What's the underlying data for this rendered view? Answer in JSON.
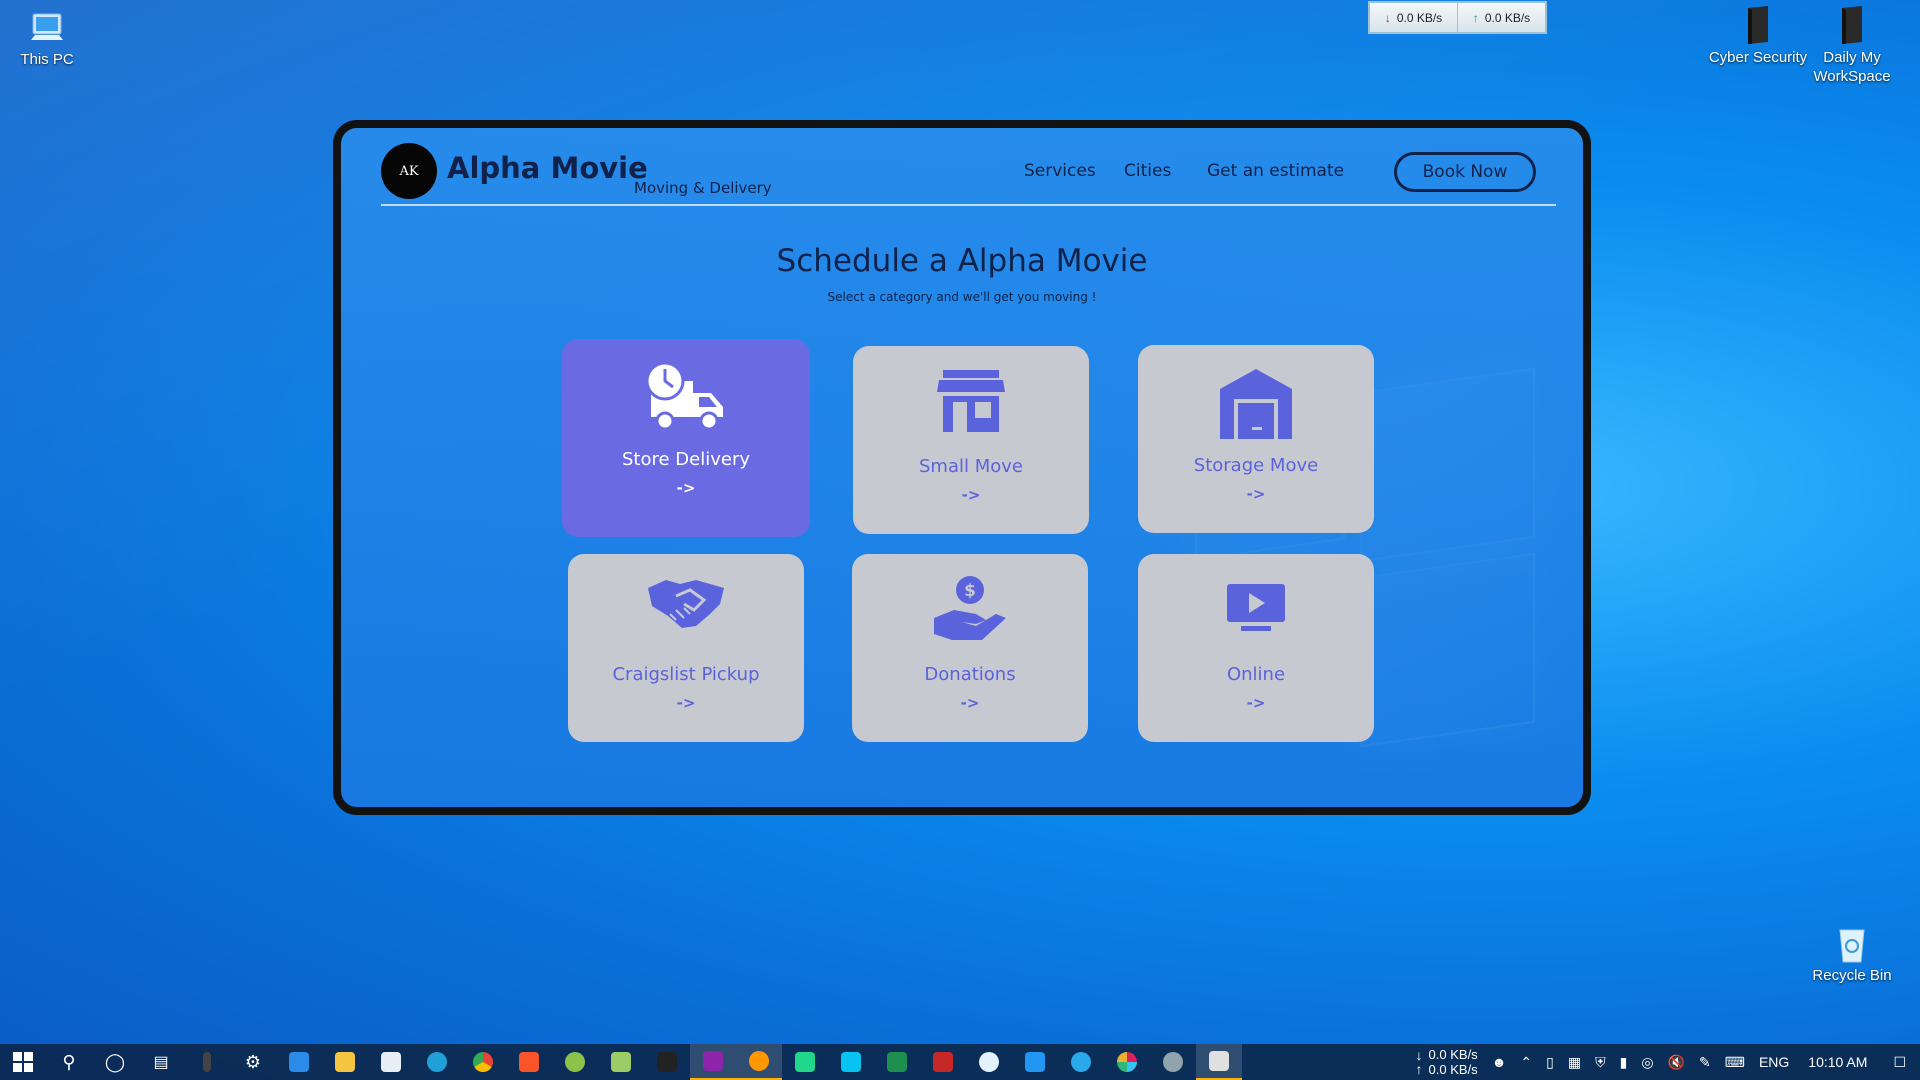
{
  "desktop": {
    "icons": [
      {
        "label": "This PC"
      },
      {
        "label": "Cyber Security"
      },
      {
        "label": "Daily My WorkSpace"
      },
      {
        "label": "Recycle Bin"
      }
    ],
    "netspeed": {
      "down": "0.0 KB/s",
      "up": "0.0 KB/s"
    }
  },
  "site": {
    "logo_text": "AK",
    "brand": "Alpha Movie",
    "tagline": "Moving & Delivery",
    "nav": {
      "services": "Services",
      "cities": "Cities",
      "estimate": "Get an estimate",
      "book": "Book Now"
    },
    "heading": "Schedule a Alpha Movie",
    "subheading": "Select a category and we'll get you moving !",
    "cards": [
      {
        "label": "Store Delivery",
        "arrow": "->",
        "icon": "delivery-truck-icon",
        "active": true
      },
      {
        "label": "Small Move",
        "arrow": "->",
        "icon": "storefront-icon"
      },
      {
        "label": "Storage Move",
        "arrow": "->",
        "icon": "warehouse-icon"
      },
      {
        "label": "Craigslist Pickup",
        "arrow": "->",
        "icon": "handshake-icon"
      },
      {
        "label": "Donations",
        "arrow": "->",
        "icon": "donation-hand-icon"
      },
      {
        "label": "Online",
        "arrow": "->",
        "icon": "video-play-icon"
      }
    ],
    "colors": {
      "accent": "#6a6ae2",
      "card_bg": "#c7c9d0",
      "card_text": "#5a63dc",
      "dark_text": "#10224a"
    }
  },
  "taskbar": {
    "download": "0.0 KB/s",
    "upload": "0.0 KB/s",
    "language": "ENG",
    "time": "10:10 AM"
  }
}
